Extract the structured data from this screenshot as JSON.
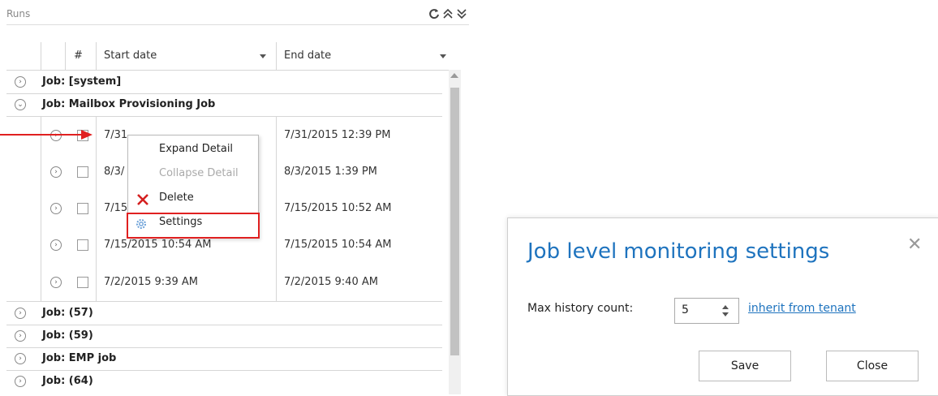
{
  "runs": {
    "title": "Runs",
    "icons": [
      "refresh-icon",
      "collapse-all-icon",
      "expand-all-icon"
    ]
  },
  "grid": {
    "columns": [
      "#",
      "Start date",
      "End date"
    ],
    "groups_top": [
      {
        "label": "Job: [system]",
        "expanded": false
      },
      {
        "label": "Job: Mailbox Provisioning Job",
        "expanded": true
      }
    ],
    "rows": [
      {
        "start": "7/31/2015 12:39 PM",
        "end": "7/31/2015 12:39 PM"
      },
      {
        "start": "8/3/",
        "end": "8/3/2015 1:39 PM"
      },
      {
        "start": "7/15",
        "end": "7/15/2015 10:52 AM"
      },
      {
        "start": "7/15/2015 10:54 AM",
        "end": "7/15/2015 10:54 AM"
      },
      {
        "start": "7/2/2015 9:39 AM",
        "end": "7/2/2015 9:40 AM"
      }
    ],
    "groups_bottom": [
      {
        "label": "Job: (57)"
      },
      {
        "label": "Job: (59)"
      },
      {
        "label": "Job: EMP job"
      },
      {
        "label": "Job: (64)"
      }
    ]
  },
  "context_menu": {
    "items": [
      {
        "label": "Expand Detail",
        "icon": "",
        "enabled": true
      },
      {
        "label": "Collapse Detail",
        "icon": "",
        "enabled": false
      },
      {
        "label": "Delete",
        "icon": "delete-x-icon",
        "enabled": true
      },
      {
        "label": "Settings",
        "icon": "gear-icon",
        "enabled": true
      }
    ]
  },
  "dialog": {
    "title": "Job level monitoring settings",
    "max_history_label": "Max history count:",
    "max_history_value": "5",
    "inherit_link": "inherit from tenant",
    "save_label": "Save",
    "close_label": "Close"
  },
  "colors": {
    "accent": "#1e73be",
    "highlight": "#e02020"
  }
}
